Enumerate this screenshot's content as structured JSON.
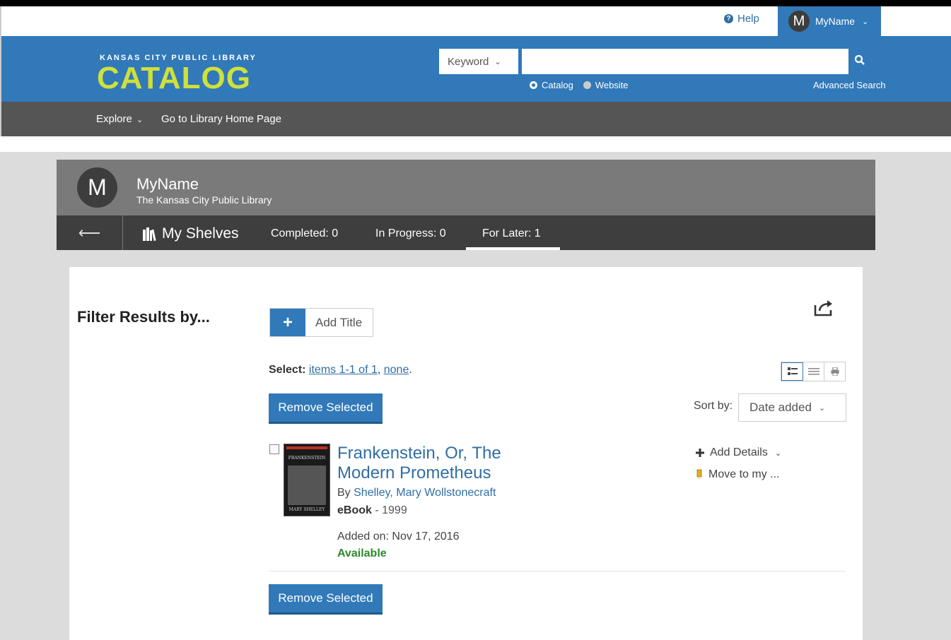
{
  "utility": {
    "help_label": "Help",
    "user_name": "MyName",
    "user_initial": "M"
  },
  "header": {
    "logo_line1": "KANSAS CITY PUBLIC LIBRARY",
    "logo_line2": "CATALOG",
    "search_type": "Keyword",
    "search_value": "",
    "radio_catalog": "Catalog",
    "radio_website": "Website",
    "advanced_search": "Advanced Search"
  },
  "nav": {
    "explore": "Explore",
    "home": "Go to Library Home Page"
  },
  "profile": {
    "initial": "M",
    "name": "MyName",
    "library": "The Kansas City Public Library"
  },
  "tabs": {
    "my_shelves": "My Shelves",
    "completed": "Completed: 0",
    "in_progress": "In Progress: 0",
    "for_later": "For Later: 1"
  },
  "main": {
    "filter_heading": "Filter Results by...",
    "add_title": "Add Title",
    "select_label": "Select:",
    "select_items": "items 1-1 of 1",
    "select_none": "none",
    "remove_selected": "Remove Selected",
    "sort_label": "Sort by:",
    "sort_value": "Date added"
  },
  "item": {
    "title": "Frankenstein, Or, The Modern Prometheus",
    "by_label": "By",
    "author": "Shelley, Mary Wollstonecraft",
    "format": "eBook",
    "year": "1999",
    "added": "Added on: Nov 17, 2016",
    "status": "Available",
    "add_details": "Add Details",
    "move_to": "Move to my ...",
    "cover_title": "FRANKENSTEIN",
    "cover_author": "MARY SHELLEY"
  },
  "colors": {
    "brand": "#3179b9",
    "logo": "#cfe03b",
    "available": "#2c8a2c"
  }
}
